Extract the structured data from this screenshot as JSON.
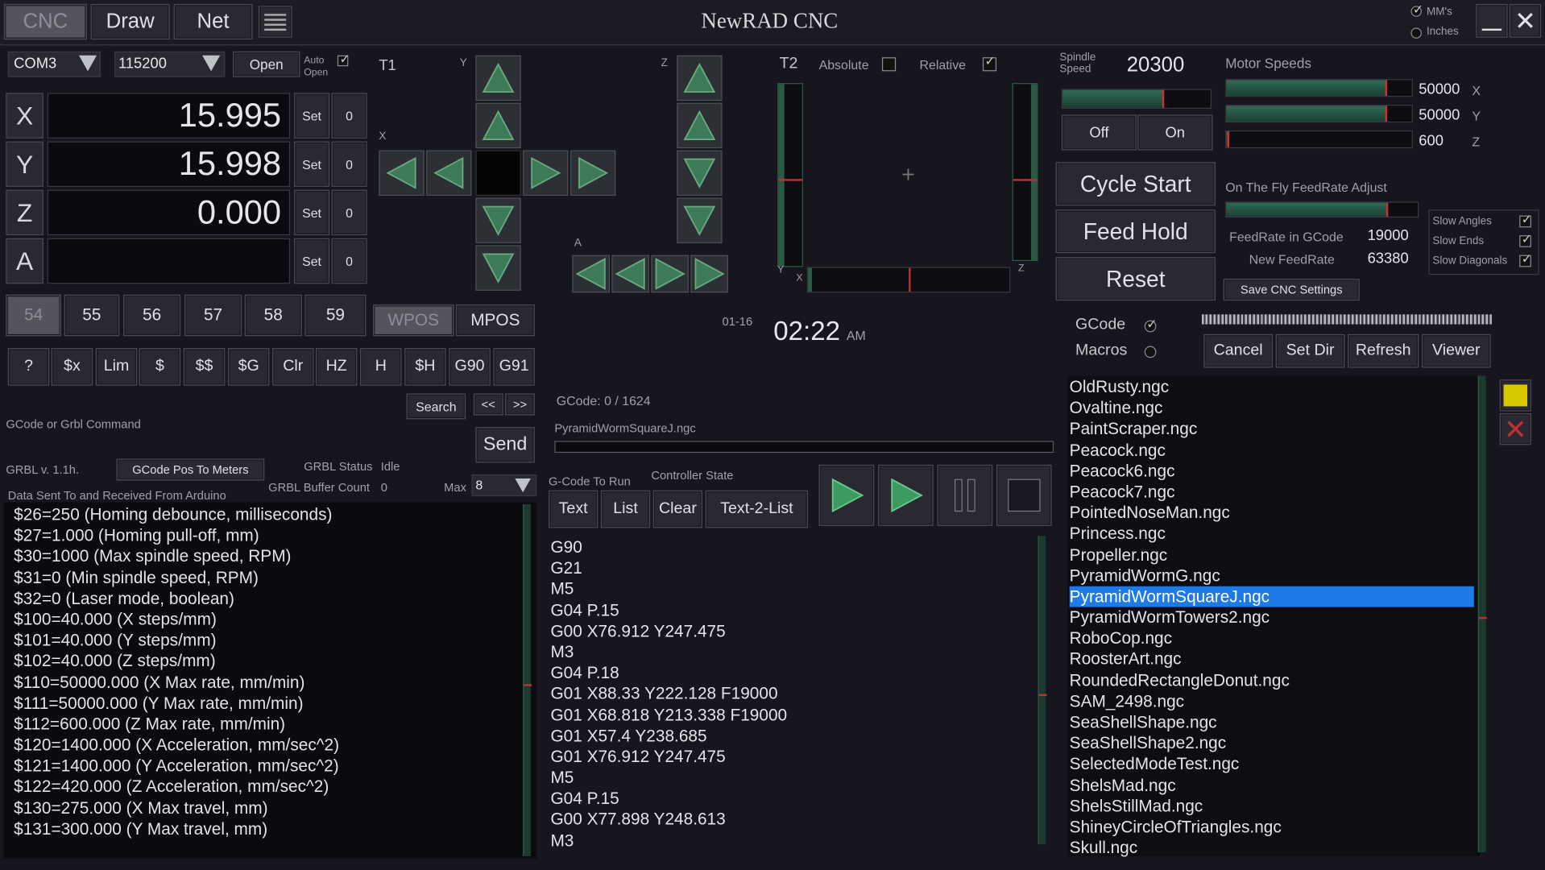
{
  "titlebar": {
    "title": "NewRAD CNC",
    "tabs": [
      "CNC",
      "Draw",
      "Net"
    ],
    "units": [
      "MM's",
      "Inches"
    ]
  },
  "conn": {
    "port": "COM3",
    "baud": "115200",
    "open": "Open",
    "auto_open": "Auto Open"
  },
  "axes": [
    {
      "name": "X",
      "value": "15.995",
      "set": "Set",
      "zero": "0"
    },
    {
      "name": "Y",
      "value": "15.998",
      "set": "Set",
      "zero": "0"
    },
    {
      "name": "Z",
      "value": "0.000",
      "set": "Set",
      "zero": "0"
    },
    {
      "name": "A",
      "value": "",
      "set": "Set",
      "zero": "0"
    }
  ],
  "coords": [
    "54",
    "55",
    "56",
    "57",
    "58",
    "59"
  ],
  "pos_buttons": [
    "WPOS",
    "MPOS"
  ],
  "commands": [
    "?",
    "$x",
    "Lim",
    "$",
    "$$",
    "$G",
    "Clr",
    "HZ",
    "H",
    "$H",
    "G90",
    "G91"
  ],
  "jog": {
    "t1": "T1",
    "t2": "T2",
    "y": "Y",
    "x": "X",
    "z": "Z",
    "a": "A"
  },
  "mode": {
    "absolute": "Absolute",
    "relative": "Relative"
  },
  "search": {
    "label": "Search",
    "prev": "<<",
    "next": ">>"
  },
  "cmdline": {
    "label": "GCode or Grbl Command",
    "send": "Send"
  },
  "grbl": {
    "version": "GRBL v. 1.1h.",
    "pos_btn": "GCode Pos To Meters",
    "status_label": "GRBL Status",
    "status": "Idle",
    "buffer_label": "GRBL Buffer Count",
    "buffer": "0",
    "max_label": "Max",
    "max": "8",
    "data_label": "Data Sent To and Received From Arduino"
  },
  "console": [
    "$26=250 (Homing debounce, milliseconds)",
    "$27=1.000 (Homing pull-off, mm)",
    "$30=1000 (Max spindle speed, RPM)",
    "$31=0 (Min spindle speed, RPM)",
    "$32=0 (Laser mode, boolean)",
    "$100=40.000 (X steps/mm)",
    "$101=40.000 (Y steps/mm)",
    "$102=40.000 (Z steps/mm)",
    "$110=50000.000 (X Max rate, mm/min)",
    "$111=50000.000 (Y Max rate, mm/min)",
    "$112=600.000 (Z Max rate, mm/min)",
    "$120=1400.000 (X Acceleration, mm/sec^2)",
    "$121=1400.000 (Y Acceleration, mm/sec^2)",
    "$122=420.000 (Z Acceleration, mm/sec^2)",
    "$130=275.000 (X Max travel, mm)",
    "$131=300.000 (Y Max travel, mm)"
  ],
  "clock": {
    "date": "01-16",
    "time": "02:22",
    "ampm": "AM"
  },
  "gcode": {
    "counter": "GCode: 0 / 1624",
    "file": "PyramidWormSquareJ.ngc",
    "run_label": "G-Code To Run",
    "state_label": "Controller State",
    "tabs": [
      "Text",
      "List",
      "Clear",
      "Text-2-List"
    ],
    "lines": [
      "G90",
      "G21",
      "M5",
      "G04 P.15",
      "G00 X76.912 Y247.475",
      "M3",
      "G04 P.18",
      "G01 X88.33 Y222.128 F19000",
      "G01 X68.818 Y213.338 F19000",
      "G01 X57.4 Y238.685",
      "G01 X76.912 Y247.475",
      "M5",
      "G04 P.15",
      "G00 X77.898 Y248.613",
      "M3"
    ]
  },
  "spindle": {
    "label": "Spindle Speed",
    "value": "20300",
    "off": "Off",
    "on": "On",
    "level": 0.68
  },
  "motors": {
    "label": "Motor Speeds",
    "rows": [
      {
        "value": "50000",
        "axis": "X",
        "level": 0.86
      },
      {
        "value": "50000",
        "axis": "Y",
        "level": 0.86
      },
      {
        "value": "600",
        "axis": "Z",
        "level": 0.01
      }
    ]
  },
  "controls": {
    "cycle": "Cycle Start",
    "hold": "Feed Hold",
    "reset": "Reset"
  },
  "feed": {
    "label": "On The Fly FeedRate Adjust",
    "level": 0.84,
    "gcode_label": "FeedRate in GCode",
    "gcode_value": "19000",
    "new_label": "New FeedRate",
    "new_value": "63380",
    "save": "Save CNC Settings"
  },
  "slow": [
    "Slow Angles",
    "Slow Ends",
    "Slow Diagonals"
  ],
  "source": {
    "gcode": "GCode",
    "macros": "Macros"
  },
  "filebtns": [
    "Cancel",
    "Set Dir",
    "Refresh",
    "Viewer"
  ],
  "files": [
    "OldRusty.ngc",
    "Ovaltine.ngc",
    "PaintScraper.ngc",
    "Peacock.ngc",
    "Peacock6.ngc",
    "Peacock7.ngc",
    "PointedNoseMan.ngc",
    "Princess.ngc",
    "Propeller.ngc",
    "PyramidWormG.ngc",
    "PyramidWormSquareJ.ngc",
    "PyramidWormTowers2.ngc",
    "RoboCop.ngc",
    "RoosterArt.ngc",
    "RoundedRectangleDonut.ngc",
    "SAM_2498.ngc",
    "SeaShellShape.ngc",
    "SeaShellShape2.ngc",
    "SelectedModeTest.ngc",
    "ShelsMad.ngc",
    "ShelsStillMad.ngc",
    "ShineyCircleOfTriangles.ngc",
    "Skull.ngc"
  ],
  "selected_file": "PyramidWormSquareJ.ngc",
  "colors": {
    "bg": "#17151e",
    "select": "#1e7ae6",
    "accent_green": "#2f6a55",
    "marker_red": "#d03030",
    "yellow": "#d8c800"
  }
}
